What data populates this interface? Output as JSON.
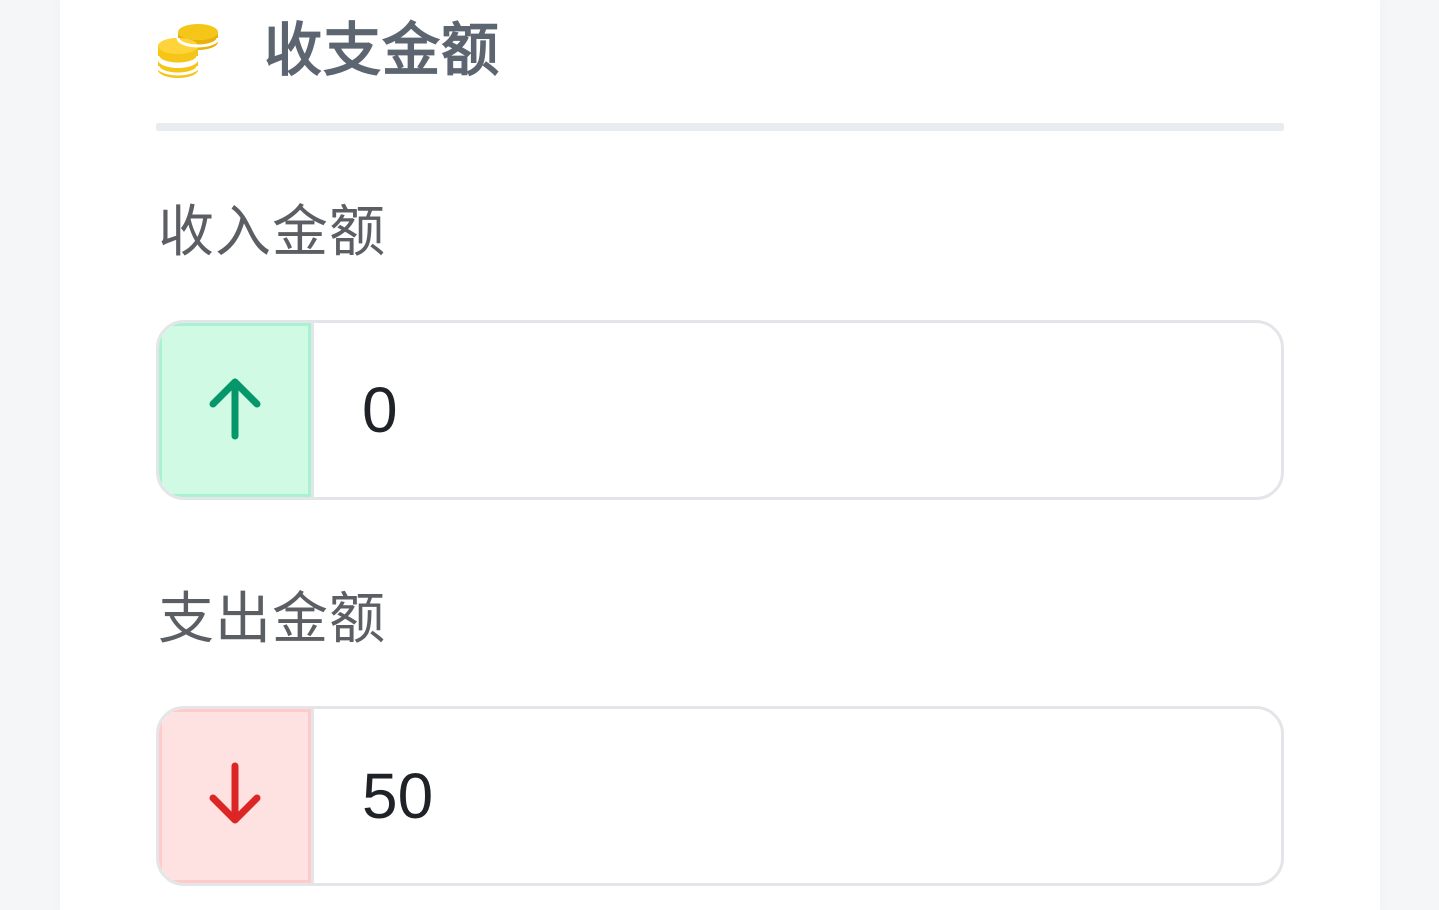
{
  "section": {
    "title": "收支金额",
    "icon": "coins-icon",
    "icon_color": "#f5c518"
  },
  "income": {
    "label": "收入金额",
    "value": "0",
    "icon": "arrow-up-icon",
    "accent": "#059669",
    "addon_bg": "#d1fae5"
  },
  "expense": {
    "label": "支出金额",
    "value": "50",
    "icon": "arrow-down-icon",
    "accent": "#dc2626",
    "addon_bg": "#fee2e2"
  }
}
